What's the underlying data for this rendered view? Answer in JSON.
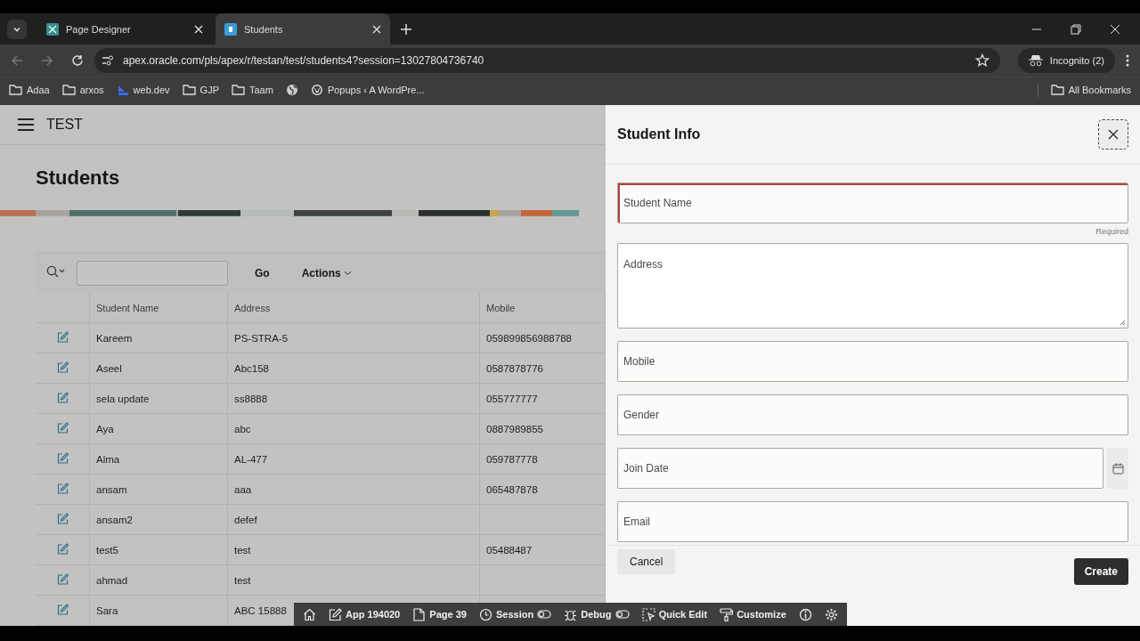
{
  "browser": {
    "tabs": [
      {
        "title": "Page Designer",
        "selected": false
      },
      {
        "title": "Students",
        "selected": true
      }
    ],
    "address": "apex.oracle.com/pls/apex/r/testan/test/students4?session=13027804736740",
    "profile": "Incognito (2)",
    "bookmarks": [
      {
        "label": "Adaa",
        "kind": "folder"
      },
      {
        "label": "arxos",
        "kind": "folder"
      },
      {
        "label": "web.dev",
        "kind": "webdev"
      },
      {
        "label": "GJP",
        "kind": "folder"
      },
      {
        "label": "Taam",
        "kind": "folder"
      },
      {
        "kind": "globe"
      },
      {
        "label": "Popups ‹ A WordPre...",
        "kind": "wp"
      }
    ],
    "all_bookmarks": "All Bookmarks"
  },
  "app": {
    "name": "TEST",
    "page_title": "Students",
    "search": {
      "go": "Go",
      "actions": "Actions"
    },
    "table": {
      "columns": [
        "Student Name",
        "Address",
        "Mobile"
      ],
      "rows": [
        [
          "Kareem",
          "PS-STRA-5",
          "059899856988788"
        ],
        [
          "Aseel",
          "Abc158",
          "0587878776"
        ],
        [
          "sela update",
          "ss8888",
          "055777777"
        ],
        [
          "Aya",
          "abc",
          "0887989855"
        ],
        [
          "Alma",
          "AL-477",
          "059787778"
        ],
        [
          "ansam",
          "aaa",
          "065487878"
        ],
        [
          "ansam2",
          "defef",
          ""
        ],
        [
          "test5",
          "test",
          "05488487"
        ],
        [
          "ahmad",
          "test",
          ""
        ],
        [
          "Sara",
          "ABC 15888",
          ""
        ]
      ]
    }
  },
  "dialog": {
    "title": "Student Info",
    "fields": [
      {
        "label": "Student Name",
        "kind": "text",
        "required": true,
        "hint": "Required"
      },
      {
        "label": "Address",
        "kind": "textarea",
        "required": false
      },
      {
        "label": "Mobile",
        "kind": "text",
        "required": false
      },
      {
        "label": "Gender",
        "kind": "text",
        "required": false
      },
      {
        "label": "Join Date",
        "kind": "date",
        "required": false
      },
      {
        "label": "Email",
        "kind": "text",
        "required": false
      }
    ],
    "cancel": "Cancel",
    "create": "Create"
  },
  "dev_toolbar": [
    {
      "kind": "home"
    },
    {
      "label": "App 194020",
      "kind": "edit"
    },
    {
      "label": "Page 39",
      "kind": "page"
    },
    {
      "label": "Session",
      "kind": "session"
    },
    {
      "label": "Debug",
      "kind": "debug"
    },
    {
      "label": "Quick Edit",
      "kind": "quick"
    },
    {
      "label": "Customize",
      "kind": "customize"
    },
    {
      "kind": "info"
    },
    {
      "kind": "gear"
    }
  ]
}
